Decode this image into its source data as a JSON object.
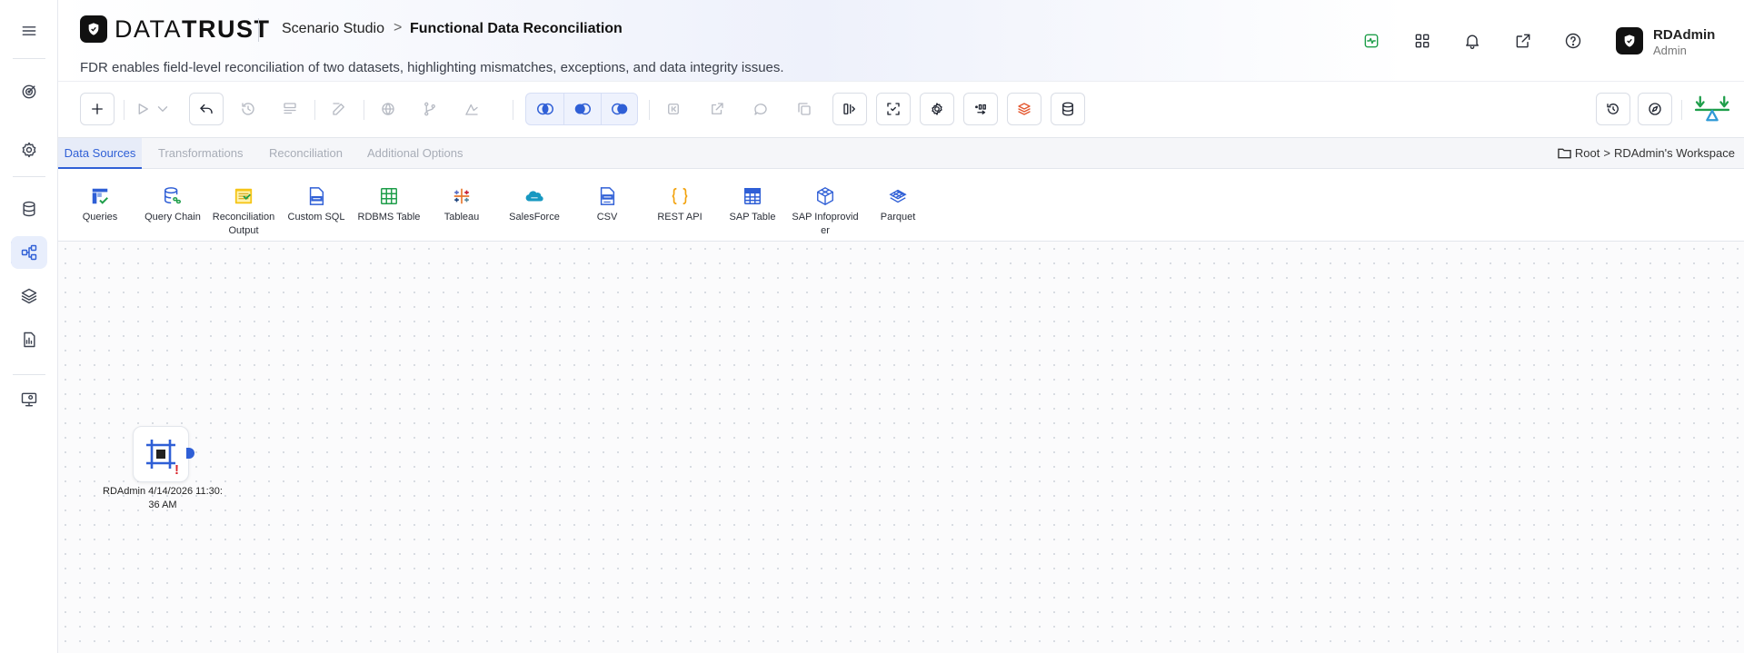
{
  "header": {
    "logo_text_light": "DATA",
    "logo_text_bold": "TRUST",
    "breadcrumb_studio": "Scenario Studio",
    "breadcrumb_sep": ">",
    "page_title": "Functional Data Reconciliation",
    "subtitle": "FDR enables field-level reconciliation of two datasets, highlighting mismatches, exceptions, and data integrity issues.",
    "user": {
      "name": "RDAdmin",
      "role": "Admin"
    },
    "icons": [
      "activity-icon",
      "grid-apps-icon",
      "bell-icon",
      "external-link-icon",
      "help-icon"
    ]
  },
  "sidebar": {
    "items": [
      {
        "name": "menu-icon"
      },
      {
        "name": "target-icon"
      },
      {
        "name": "settings-icon"
      },
      {
        "name": "database-icon"
      },
      {
        "name": "workflow-icon",
        "active": true
      },
      {
        "name": "layers-icon"
      },
      {
        "name": "report-icon"
      },
      {
        "name": "monitor-settings-icon"
      }
    ]
  },
  "tabs": [
    {
      "label": "Data Sources",
      "active": true
    },
    {
      "label": "Transformations",
      "active": false
    },
    {
      "label": "Reconciliation",
      "active": false
    },
    {
      "label": "Additional Options",
      "active": false
    }
  ],
  "path": {
    "root": "Root",
    "sep": ">",
    "workspace": "RDAdmin's Workspace"
  },
  "palette": [
    {
      "label": "Queries",
      "icon": "queries-icon"
    },
    {
      "label": "Query Chain",
      "icon": "query-chain-icon"
    },
    {
      "label": "Reconciliation Output",
      "icon": "reconciliation-output-icon"
    },
    {
      "label": "Custom SQL",
      "icon": "sql-file-icon"
    },
    {
      "label": "RDBMS Table",
      "icon": "table-icon"
    },
    {
      "label": "Tableau",
      "icon": "tableau-icon"
    },
    {
      "label": "SalesForce",
      "icon": "salesforce-cloud-icon"
    },
    {
      "label": "CSV",
      "icon": "csv-file-icon"
    },
    {
      "label": "REST API",
      "icon": "braces-icon"
    },
    {
      "label": "SAP Table",
      "icon": "sap-table-icon"
    },
    {
      "label": "SAP Infoprovider",
      "icon": "cube-icon"
    },
    {
      "label": "Parquet",
      "icon": "parquet-icon"
    }
  ],
  "canvas": {
    "node": {
      "label": "RDAdmin 4/14/2026 11:30:36 AM",
      "warning": "!",
      "icon": "frame-node-icon"
    }
  },
  "colors": {
    "accent": "#2f5fd6",
    "warning": "#d9262c",
    "activity_green": "#1e9e4a",
    "balance_green": "#1e9e4a",
    "balance_blue": "#2f9ad6"
  }
}
